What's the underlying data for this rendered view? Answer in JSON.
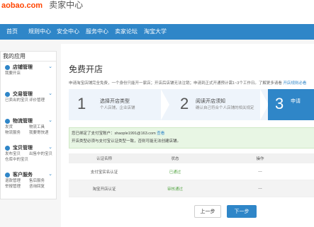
{
  "header": {
    "logo_domain": "aobao.com",
    "logo_center": "卖家中心"
  },
  "nav": {
    "items": [
      "首页",
      "规则中心",
      "安全中心",
      "服务中心",
      "卖家论坛",
      "淘宝大学"
    ]
  },
  "sidebar": {
    "header": "我的应用",
    "groups": [
      {
        "title": "店铺管理",
        "links": [
          "我要开店"
        ]
      },
      {
        "title": "交易管理",
        "links": [
          "已卖出的宝贝",
          "评价管理"
        ]
      },
      {
        "title": "物流管理",
        "links": [
          "发货",
          "物流工具",
          "物流服务",
          "我要寄快递"
        ]
      },
      {
        "title": "宝贝管理",
        "links": [
          "发布宝贝",
          "出售中的宝贝",
          "仓库中的宝贝"
        ]
      },
      {
        "title": "客户服务",
        "links": [
          "退款管理",
          "售后服务",
          "举报管理",
          "咨询回复"
        ]
      }
    ]
  },
  "main": {
    "title": "免费开店",
    "intro": "申请淘宝店铺完全免费，一个身份只能开一家店；开店后店铺无法注销；申请到正式开通预计需1~3个工作日。了解更多请看",
    "intro_link": "开店规则必看",
    "steps": [
      {
        "number": "1",
        "title": "选择开店类型",
        "desc": "个人店铺，企业店铺"
      },
      {
        "number": "2",
        "title": "阅读开店须知",
        "desc": "确认自己符合个人店铺的相关规定"
      },
      {
        "number": "3",
        "title": "申请",
        "desc": ""
      }
    ],
    "notice": {
      "line1_prefix": "您已绑定了支付宝账户：shaople1991@163.com",
      "line1_link": "查看",
      "line2": "开店类型必须与支付宝认证类型一致，否则可能无法创建店铺。"
    },
    "table": {
      "headers": [
        "认证名称",
        "状态",
        "操作"
      ],
      "rows": [
        {
          "name": "支付宝实名认证",
          "status": "已通过",
          "action": "---"
        },
        {
          "name": "淘宝开店认证",
          "status": "审核通过",
          "action": "---"
        }
      ]
    },
    "buttons": {
      "prev": "上一步",
      "next": "下一步"
    }
  },
  "colors": {
    "accent": "#2f86c8",
    "success": "#5aa84a",
    "brand": "#ff4400"
  }
}
